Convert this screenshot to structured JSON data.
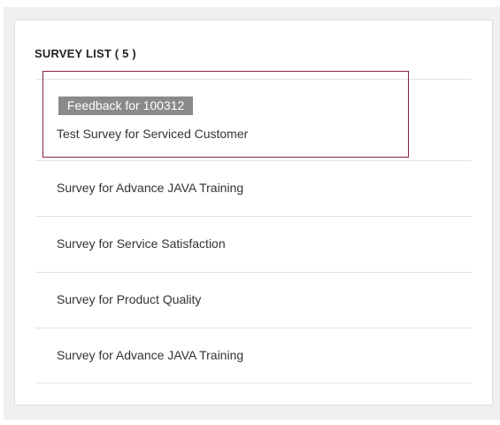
{
  "survey_list": {
    "title": "SURVEY LIST ( 5 )",
    "tooltip": "Feedback for 100312",
    "items": [
      {
        "label": "Test Survey for Serviced Customer",
        "selected": true
      },
      {
        "label": "Survey for Advance JAVA Training",
        "selected": false
      },
      {
        "label": "Survey for Service Satisfaction",
        "selected": false
      },
      {
        "label": "Survey for Product Quality",
        "selected": false
      },
      {
        "label": "Survey for Advance JAVA Training",
        "selected": false
      }
    ]
  },
  "colors": {
    "selection_border": "#8b1e3f",
    "tooltip_background": "#8a8a8a",
    "panel_background": "#f0f0f0"
  }
}
